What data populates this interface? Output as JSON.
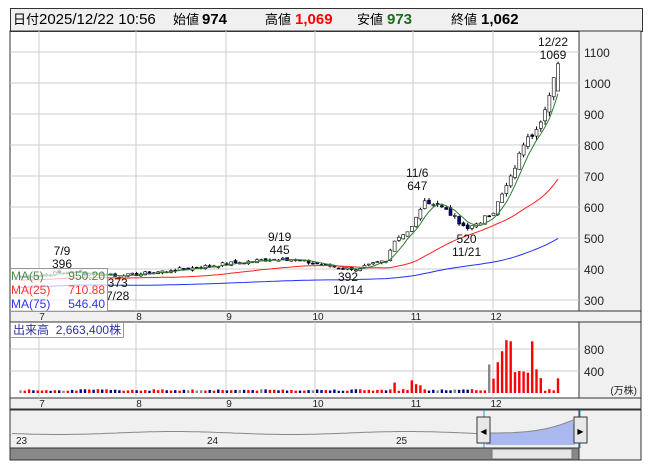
{
  "header": {
    "date_label": "日付",
    "date": "2025/12/22 10:56",
    "open_label": "始値",
    "open": "974",
    "high_label": "高値",
    "high": "1,069",
    "low_label": "安値",
    "low": "973",
    "close_label": "終値",
    "close": "1,062"
  },
  "legend": {
    "ma5_label": "MA(5)",
    "ma5": "950.20",
    "ma25_label": "MA(25)",
    "ma25": "710.88",
    "ma75_label": "MA(75)",
    "ma75": "546.40"
  },
  "volume_legend": {
    "label": "出来高",
    "value": "2,663,400株"
  },
  "annotations": [
    {
      "date": "7/9",
      "price": "396"
    },
    {
      "date": "7/28",
      "price": "373"
    },
    {
      "date": "9/19",
      "price": "445"
    },
    {
      "date": "10/14",
      "price": "392"
    },
    {
      "date": "11/6",
      "price": "647"
    },
    {
      "date": "11/21",
      "price": "520"
    },
    {
      "date": "12/22",
      "price": "1069"
    }
  ],
  "colors": {
    "up": "#ff0000",
    "down": "#00008b",
    "ma5": "#2e7d32",
    "ma25": "#ff2020",
    "ma75": "#2030ff"
  },
  "chart_data": {
    "type": "candlestick",
    "price_ticks": [
      "1100",
      "1000",
      "900",
      "800",
      "700",
      "600",
      "500",
      "400",
      "300"
    ],
    "price_range": [
      270,
      1120
    ],
    "month_labels": [
      "7",
      "8",
      "9",
      "10",
      "11",
      "12"
    ],
    "volume_ticks": [
      "800",
      "400"
    ],
    "volume_unit": "(万株)",
    "navigator_labels": [
      "23",
      "24",
      "25"
    ],
    "close_anchors": [
      [
        -5,
        375
      ],
      [
        6,
        390
      ],
      [
        19,
        378
      ],
      [
        30,
        395
      ],
      [
        45,
        420
      ],
      [
        56,
        435
      ],
      [
        72,
        398
      ],
      [
        80,
        425
      ],
      [
        82,
        490
      ],
      [
        85,
        520
      ],
      [
        89,
        620
      ],
      [
        93,
        600
      ],
      [
        99,
        530
      ],
      [
        105,
        580
      ],
      [
        109,
        700
      ],
      [
        112,
        800
      ],
      [
        115,
        850
      ],
      [
        118,
        960
      ],
      [
        120,
        1062
      ]
    ],
    "volume_spikes": [
      [
        82,
        190
      ],
      [
        86,
        230
      ],
      [
        87,
        160
      ],
      [
        88,
        140
      ],
      [
        104,
        520
      ],
      [
        105,
        260
      ],
      [
        106,
        560
      ],
      [
        107,
        760
      ],
      [
        108,
        960
      ],
      [
        109,
        940
      ],
      [
        110,
        380
      ],
      [
        111,
        400
      ],
      [
        112,
        390
      ],
      [
        113,
        370
      ],
      [
        114,
        940
      ],
      [
        115,
        430
      ],
      [
        116,
        270
      ],
      [
        120,
        266
      ]
    ]
  }
}
